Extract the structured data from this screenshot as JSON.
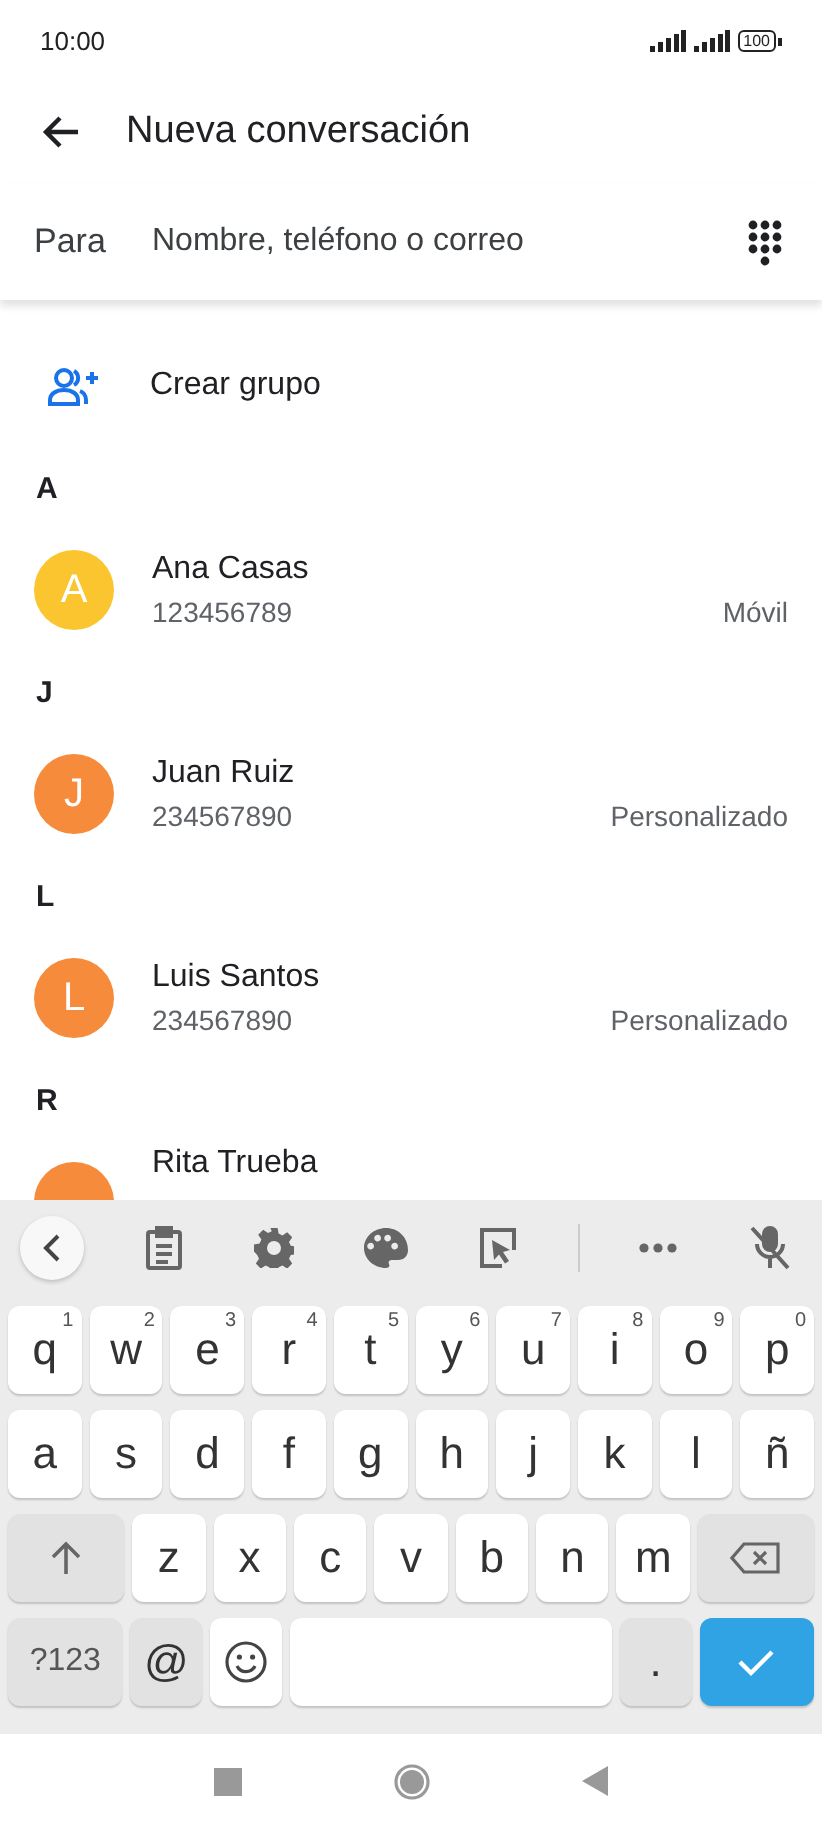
{
  "status_bar": {
    "time": "10:00",
    "battery": "100"
  },
  "app_bar": {
    "title": "Nueva conversación"
  },
  "recipient": {
    "label": "Para",
    "placeholder": "Nombre, teléfono o correo"
  },
  "create_group": {
    "label": "Crear grupo"
  },
  "sections": [
    {
      "letter": "A",
      "contacts": [
        {
          "name": "Ana Casas",
          "initial": "A",
          "color": "#fbc52f",
          "number": "123456789",
          "type": "Móvil"
        }
      ]
    },
    {
      "letter": "J",
      "contacts": [
        {
          "name": "Juan Ruiz",
          "initial": "J",
          "color": "#f68b3c",
          "number": "234567890",
          "type": "Personalizado"
        }
      ]
    },
    {
      "letter": "L",
      "contacts": [
        {
          "name": "Luis Santos",
          "initial": "L",
          "color": "#f68b3c",
          "number": "234567890",
          "type": "Personalizado"
        }
      ]
    },
    {
      "letter": "R",
      "contacts": [
        {
          "name": "Rita Trueba",
          "color": "#f68b3c"
        }
      ]
    }
  ],
  "keyboard": {
    "rows": [
      {
        "keys": [
          {
            "kind": "char",
            "label": "q",
            "hint": "1"
          },
          {
            "kind": "char",
            "label": "w",
            "hint": "2"
          },
          {
            "kind": "char",
            "label": "e",
            "hint": "3"
          },
          {
            "kind": "char",
            "label": "r",
            "hint": "4"
          },
          {
            "kind": "char",
            "label": "t",
            "hint": "5"
          },
          {
            "kind": "char",
            "label": "y",
            "hint": "6"
          },
          {
            "kind": "char",
            "label": "u",
            "hint": "7"
          },
          {
            "kind": "char",
            "label": "i",
            "hint": "8"
          },
          {
            "kind": "char",
            "label": "o",
            "hint": "9"
          },
          {
            "kind": "char",
            "label": "p",
            "hint": "0"
          }
        ]
      },
      {
        "keys": [
          {
            "kind": "char",
            "label": "a"
          },
          {
            "kind": "char",
            "label": "s"
          },
          {
            "kind": "char",
            "label": "d"
          },
          {
            "kind": "char",
            "label": "f"
          },
          {
            "kind": "char",
            "label": "g"
          },
          {
            "kind": "char",
            "label": "h"
          },
          {
            "kind": "char",
            "label": "j"
          },
          {
            "kind": "char",
            "label": "k"
          },
          {
            "kind": "char",
            "label": "l"
          },
          {
            "kind": "char",
            "label": "ñ"
          }
        ]
      },
      {
        "keys": [
          {
            "kind": "shift"
          },
          {
            "kind": "char",
            "label": "z"
          },
          {
            "kind": "char",
            "label": "x"
          },
          {
            "kind": "char",
            "label": "c"
          },
          {
            "kind": "char",
            "label": "v"
          },
          {
            "kind": "char",
            "label": "b"
          },
          {
            "kind": "char",
            "label": "n"
          },
          {
            "kind": "char",
            "label": "m"
          },
          {
            "kind": "backspace"
          }
        ]
      },
      {
        "keys": [
          {
            "kind": "mode",
            "label": "?123"
          },
          {
            "kind": "symbol",
            "label": "@"
          },
          {
            "kind": "emoji"
          },
          {
            "kind": "space"
          },
          {
            "kind": "symbol",
            "label": "."
          },
          {
            "kind": "enter"
          }
        ]
      }
    ]
  }
}
